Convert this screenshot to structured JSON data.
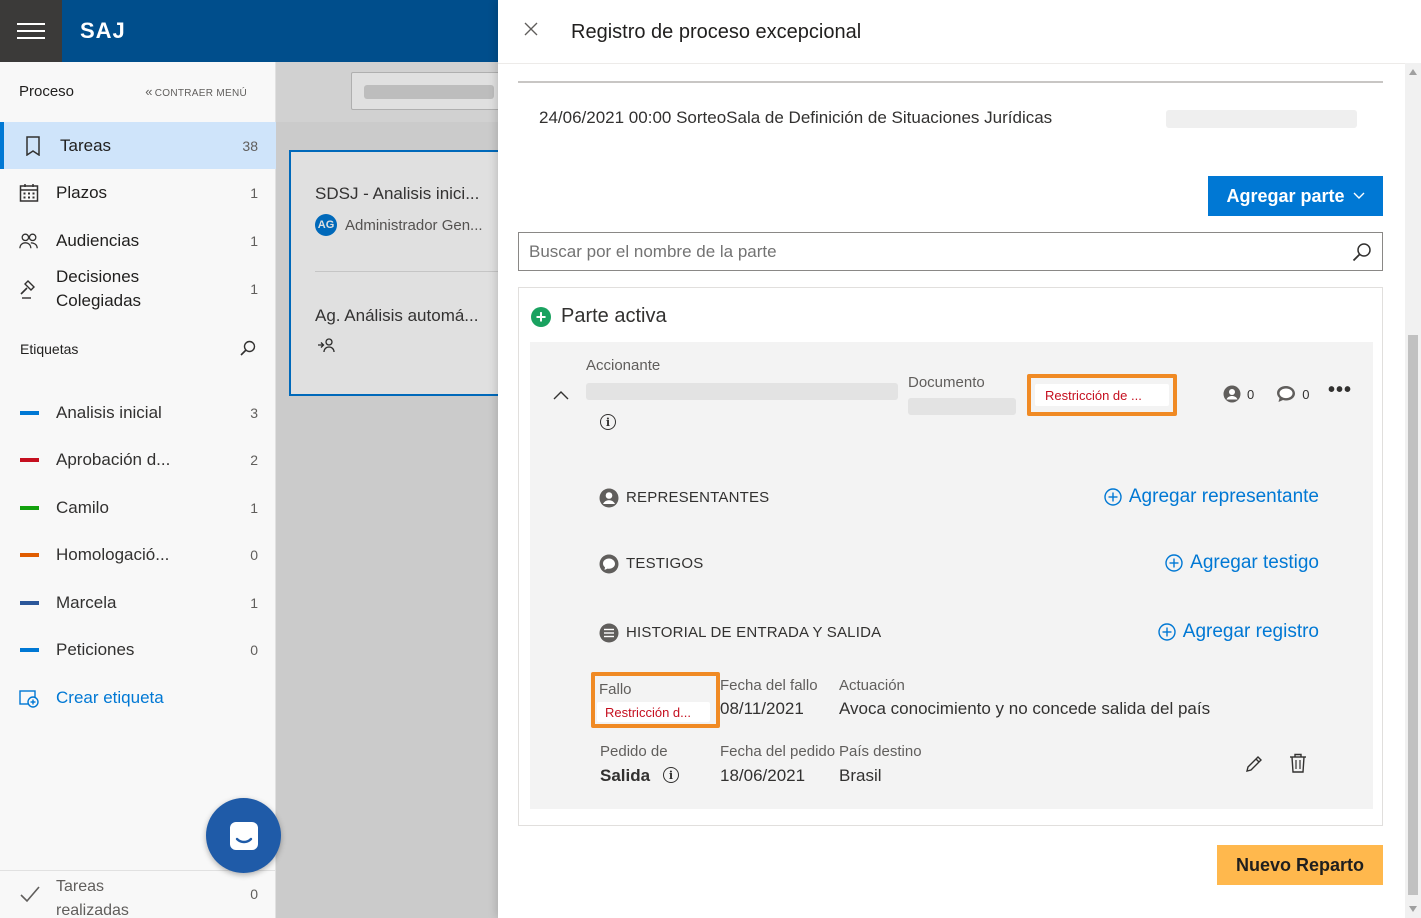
{
  "app": {
    "brand": "SAJ"
  },
  "sidebar": {
    "section_title": "Proceso",
    "collapse_label": "CONTRAER MENÚ",
    "items": [
      {
        "label": "Tareas",
        "count": "38"
      },
      {
        "label": "Plazos",
        "count": "1"
      },
      {
        "label": "Audiencias",
        "count": "1"
      },
      {
        "label": "Decisiones Colegiadas",
        "count": "1"
      }
    ],
    "tags_title": "Etiquetas",
    "tags": [
      {
        "label": "Analisis inicial",
        "count": "3",
        "color": "#0078d4"
      },
      {
        "label": "Aprobación d...",
        "count": "2",
        "color": "#c50f1f"
      },
      {
        "label": "Camilo",
        "count": "1",
        "color": "#13a10e"
      },
      {
        "label": "Homologació...",
        "count": "0",
        "color": "#e05c00"
      },
      {
        "label": "Marcela",
        "count": "1",
        "color": "#2b579a"
      },
      {
        "label": "Peticiones",
        "count": "0",
        "color": "#0078d4"
      }
    ],
    "create_tag_label": "Crear etiqueta",
    "done": {
      "label": "Tareas realizadas",
      "count": "0"
    }
  },
  "task_list": {
    "card_title_1": "SDSJ - Analisis inici...",
    "user_initials": "AG",
    "user_name": "Administrador Gen...",
    "card_title_2": "Ag. Análisis automá..."
  },
  "panel": {
    "title": "Registro de proceso excepcional",
    "info_row": "24/06/2021 00:00 SorteoSala de Definición de Situaciones Jurídicas",
    "add_party_label": "Agregar parte",
    "search_placeholder": "Buscar por el nombre de la parte",
    "party": {
      "header": "Parte activa",
      "accionante_label": "Accionante",
      "documento_label": "Documento",
      "restriction_chip": "Restricción de ...",
      "person_count": "0",
      "comment_count": "0",
      "sections": [
        {
          "label": "REPRESENTANTES",
          "action": "Agregar representante"
        },
        {
          "label": "TESTIGOS",
          "action": "Agregar testigo"
        },
        {
          "label": "HISTORIAL DE ENTRADA Y SALIDA",
          "action": "Agregar registro"
        }
      ],
      "history": {
        "fallo_label": "Fallo",
        "fallo_chip": "Restricción d...",
        "fecha_fallo_label": "Fecha del fallo",
        "fecha_fallo_value": "08/11/2021",
        "actuacion_label": "Actuación",
        "actuacion_value": "Avoca conocimiento y no concede salida del país",
        "pedido_label": "Pedido de",
        "pedido_value": "Salida",
        "fecha_pedido_label": "Fecha del pedido",
        "fecha_pedido_value": "18/06/2021",
        "pais_label": "País destino",
        "pais_value": "Brasil"
      }
    },
    "new_button_label": "Nuevo Reparto"
  }
}
